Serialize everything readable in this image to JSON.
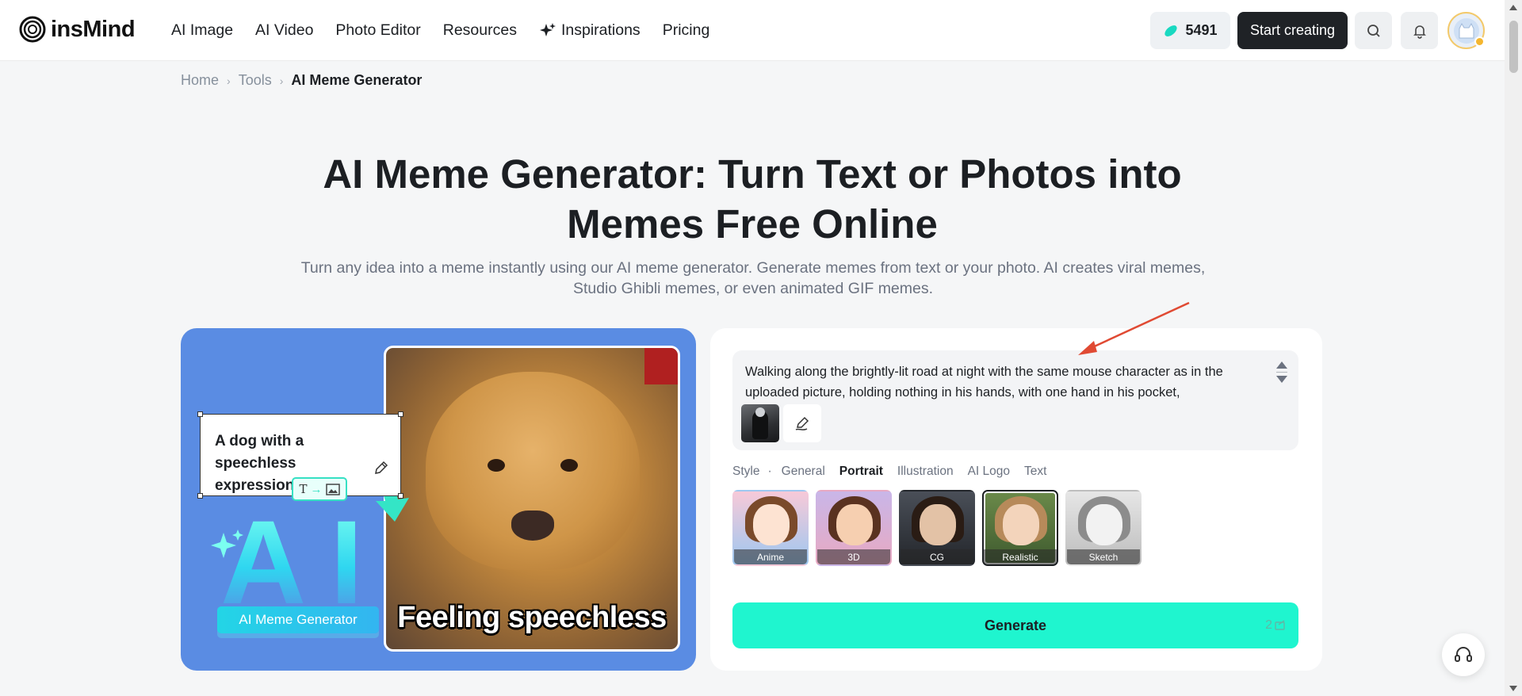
{
  "header": {
    "logo_text": "insMind",
    "nav": [
      {
        "label": "AI Image"
      },
      {
        "label": "AI Video"
      },
      {
        "label": "Photo Editor"
      },
      {
        "label": "Resources"
      },
      {
        "label": "Inspirations",
        "icon": "sparkle-icon"
      },
      {
        "label": "Pricing"
      }
    ],
    "credits": "5491",
    "start_label": "Start creating"
  },
  "breadcrumb": {
    "home": "Home",
    "tools": "Tools",
    "current": "AI Meme Generator"
  },
  "hero": {
    "title": "AI Meme Generator: Turn Text or Photos into Memes Free Online",
    "subtitle": "Turn any idea into a meme instantly using our AI meme generator. Generate memes from text or your photo. AI creates viral memes, Studio Ghibli memes, or even animated GIF memes."
  },
  "illustration": {
    "speech_text": "A dog with a speechless expression...I",
    "caption": "Feeling speechless",
    "ai_text": "AI",
    "badge": "AI Meme Generator"
  },
  "form": {
    "prompt": "Walking along the brightly-lit road at night with the same mouse character as in the uploaded picture, holding nothing in his hands, with one hand in his pocket,",
    "style_label": "Style",
    "style_tabs": [
      "General",
      "Portrait",
      "Illustration",
      "AI Logo",
      "Text"
    ],
    "active_tab": "Portrait",
    "styles": [
      {
        "label": "Anime"
      },
      {
        "label": "3D"
      },
      {
        "label": "CG"
      },
      {
        "label": "Realistic",
        "selected": true
      },
      {
        "label": "Sketch"
      }
    ],
    "generate_label": "Generate",
    "generate_cost": "2"
  },
  "colors": {
    "accent": "#1ff5cf",
    "illustration_bg": "#5a8ce3",
    "start_button": "#1f2226",
    "annotation_arrow": "#e04a33"
  }
}
